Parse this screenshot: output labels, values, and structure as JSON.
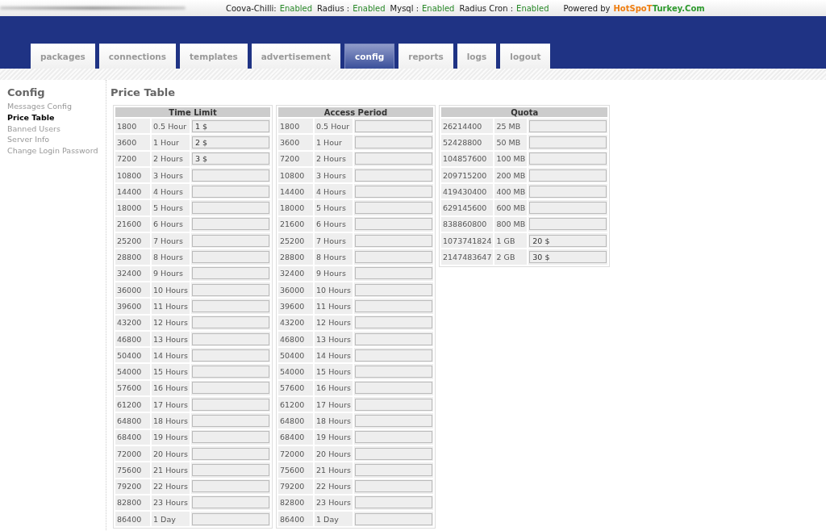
{
  "status_bar": {
    "services": [
      {
        "name": "Coova-Chilli:",
        "status": "Enabled"
      },
      {
        "name": "Radius :",
        "status": "Enabled"
      },
      {
        "name": "Mysql :",
        "status": "Enabled"
      },
      {
        "name": "Radius Cron :",
        "status": "Enabled"
      }
    ],
    "powered_by": "Powered by",
    "brand": [
      {
        "text": "HotSpoT",
        "color": "#ef7d0f"
      },
      {
        "text": "Turkey.Com",
        "color": "#2e9a2e"
      }
    ]
  },
  "tabs": [
    {
      "label": "packages",
      "selected": false
    },
    {
      "label": "connections",
      "selected": false
    },
    {
      "label": "templates",
      "selected": false
    },
    {
      "label": "advertisement",
      "selected": false
    },
    {
      "label": "config",
      "selected": true
    },
    {
      "label": "reports",
      "selected": false
    },
    {
      "label": "logs",
      "selected": false
    },
    {
      "label": "logout",
      "selected": false
    }
  ],
  "sidebar": {
    "title": "Config",
    "items": [
      {
        "label": "Messages Config",
        "selected": false
      },
      {
        "label": "Price Table",
        "selected": true
      },
      {
        "label": "Banned Users",
        "selected": false
      },
      {
        "label": "Server Info",
        "selected": false
      },
      {
        "label": "Change Login Password",
        "selected": false
      }
    ]
  },
  "page_title": "Price Table",
  "tables": [
    {
      "title": "Time Limit",
      "rows": [
        [
          "1800",
          "0.5 Hour",
          "1 $"
        ],
        [
          "3600",
          "1 Hour",
          "2 $"
        ],
        [
          "7200",
          "2 Hours",
          "3 $"
        ],
        [
          "10800",
          "3 Hours",
          ""
        ],
        [
          "14400",
          "4 Hours",
          ""
        ],
        [
          "18000",
          "5 Hours",
          ""
        ],
        [
          "21600",
          "6 Hours",
          ""
        ],
        [
          "25200",
          "7 Hours",
          ""
        ],
        [
          "28800",
          "8 Hours",
          ""
        ],
        [
          "32400",
          "9 Hours",
          ""
        ],
        [
          "36000",
          "10 Hours",
          ""
        ],
        [
          "39600",
          "11 Hours",
          ""
        ],
        [
          "43200",
          "12 Hours",
          ""
        ],
        [
          "46800",
          "13 Hours",
          ""
        ],
        [
          "50400",
          "14 Hours",
          ""
        ],
        [
          "54000",
          "15 Hours",
          ""
        ],
        [
          "57600",
          "16 Hours",
          ""
        ],
        [
          "61200",
          "17 Hours",
          ""
        ],
        [
          "64800",
          "18 Hours",
          ""
        ],
        [
          "68400",
          "19 Hours",
          ""
        ],
        [
          "72000",
          "20 Hours",
          ""
        ],
        [
          "75600",
          "21 Hours",
          ""
        ],
        [
          "79200",
          "22 Hours",
          ""
        ],
        [
          "82800",
          "23 Hours",
          ""
        ],
        [
          "86400",
          "1 Day",
          ""
        ]
      ]
    },
    {
      "title": "Access Period",
      "rows": [
        [
          "1800",
          "0.5 Hour",
          ""
        ],
        [
          "3600",
          "1 Hour",
          ""
        ],
        [
          "7200",
          "2 Hours",
          ""
        ],
        [
          "10800",
          "3 Hours",
          ""
        ],
        [
          "14400",
          "4 Hours",
          ""
        ],
        [
          "18000",
          "5 Hours",
          ""
        ],
        [
          "21600",
          "6 Hours",
          ""
        ],
        [
          "25200",
          "7 Hours",
          ""
        ],
        [
          "28800",
          "8 Hours",
          ""
        ],
        [
          "32400",
          "9 Hours",
          ""
        ],
        [
          "36000",
          "10 Hours",
          ""
        ],
        [
          "39600",
          "11 Hours",
          ""
        ],
        [
          "43200",
          "12 Hours",
          ""
        ],
        [
          "46800",
          "13 Hours",
          ""
        ],
        [
          "50400",
          "14 Hours",
          ""
        ],
        [
          "54000",
          "15 Hours",
          ""
        ],
        [
          "57600",
          "16 Hours",
          ""
        ],
        [
          "61200",
          "17 Hours",
          ""
        ],
        [
          "64800",
          "18 Hours",
          ""
        ],
        [
          "68400",
          "19 Hours",
          ""
        ],
        [
          "72000",
          "20 Hours",
          ""
        ],
        [
          "75600",
          "21 Hours",
          ""
        ],
        [
          "79200",
          "22 Hours",
          ""
        ],
        [
          "82800",
          "23 Hours",
          ""
        ],
        [
          "86400",
          "1 Day",
          ""
        ]
      ]
    },
    {
      "title": "Quota",
      "rows": [
        [
          "26214400",
          "25 MB",
          ""
        ],
        [
          "52428800",
          "50 MB",
          ""
        ],
        [
          "104857600",
          "100 MB",
          ""
        ],
        [
          "209715200",
          "200 MB",
          ""
        ],
        [
          "419430400",
          "400 MB",
          ""
        ],
        [
          "629145600",
          "600 MB",
          ""
        ],
        [
          "838860800",
          "800 MB",
          ""
        ],
        [
          "1073741824",
          "1 GB",
          "20 $"
        ],
        [
          "2147483647",
          "2 GB",
          "30 $"
        ]
      ]
    }
  ]
}
